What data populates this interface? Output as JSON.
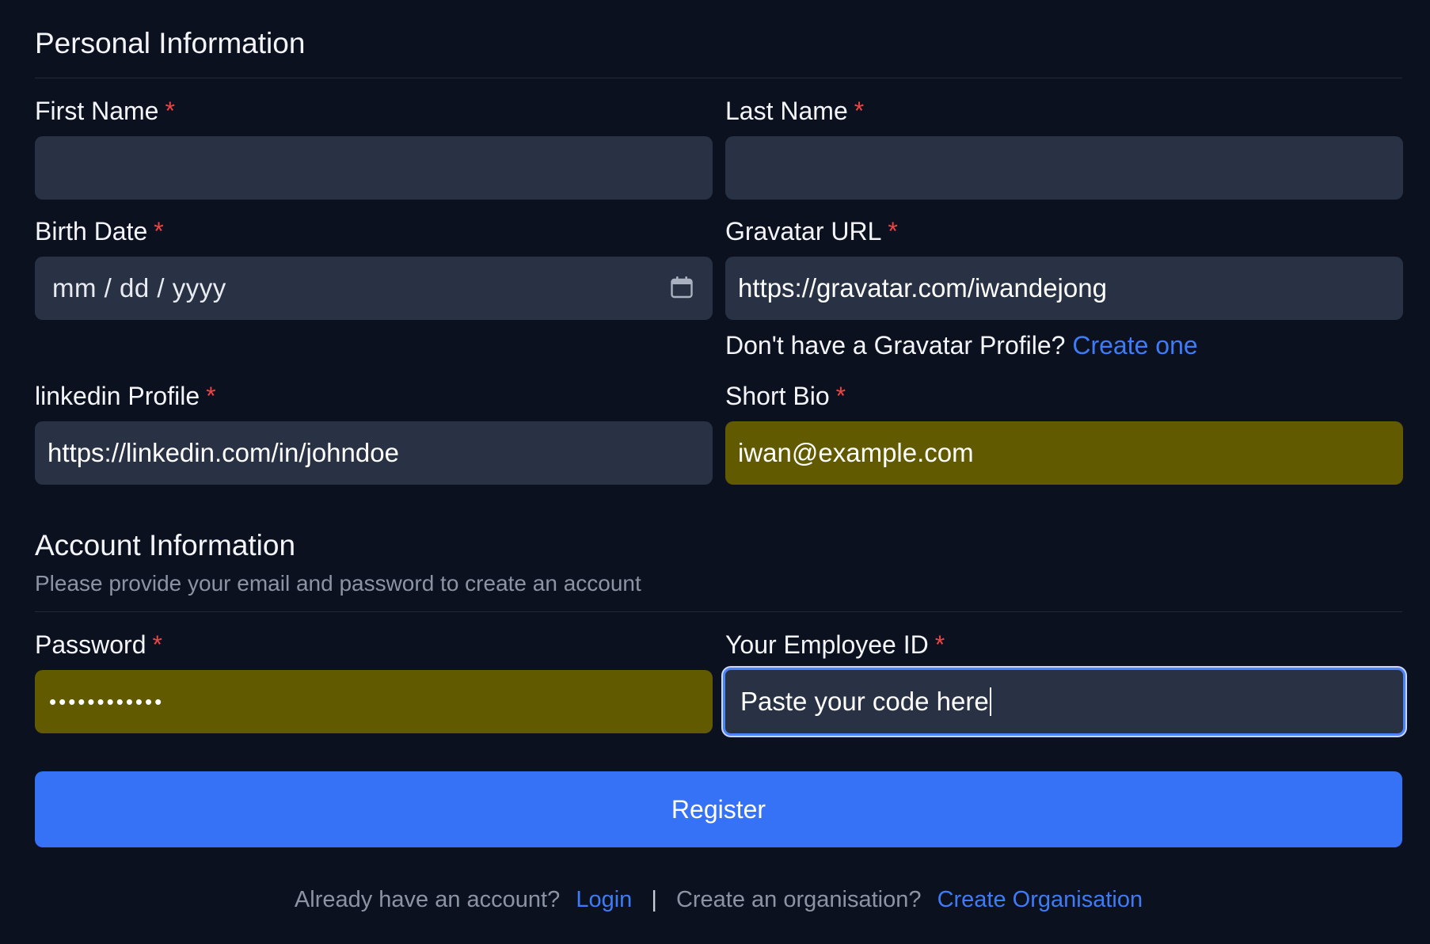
{
  "personal": {
    "title": "Personal Information",
    "first_name_label": "First Name",
    "first_name_value": "",
    "last_name_label": "Last Name",
    "last_name_value": "",
    "birth_date_label": "Birth Date",
    "birth_date_placeholder": "mm / dd / yyyy",
    "gravatar_label": "Gravatar URL",
    "gravatar_value": "https://gravatar.com/iwandejong",
    "gravatar_helper": "Don't have a Gravatar Profile?",
    "gravatar_create_link": "Create one",
    "linkedin_label": "linkedin Profile",
    "linkedin_value": "https://linkedin.com/in/johndoe",
    "bio_label": "Short Bio",
    "bio_value": "iwan@example.com",
    "required_marker": "*"
  },
  "account": {
    "title": "Account Information",
    "subtitle": "Please provide your email and password to create an account",
    "password_label": "Password",
    "password_value": "••••••••••••",
    "employee_id_label": "Your Employee ID",
    "employee_id_value": "Paste your code here"
  },
  "actions": {
    "register_label": "Register"
  },
  "footer": {
    "have_account_text": "Already have an account?",
    "login_link": "Login",
    "separator": "|",
    "create_org_text": "Create an organisation?",
    "create_org_link": "Create Organisation"
  },
  "colors": {
    "background": "#0c1120",
    "input_bg": "#283244",
    "autofill_bg": "#615a00",
    "accent": "#3572f6",
    "link": "#3e7bf6",
    "required": "#ef4444"
  },
  "icons": {
    "birth_date": "calendar-icon"
  }
}
